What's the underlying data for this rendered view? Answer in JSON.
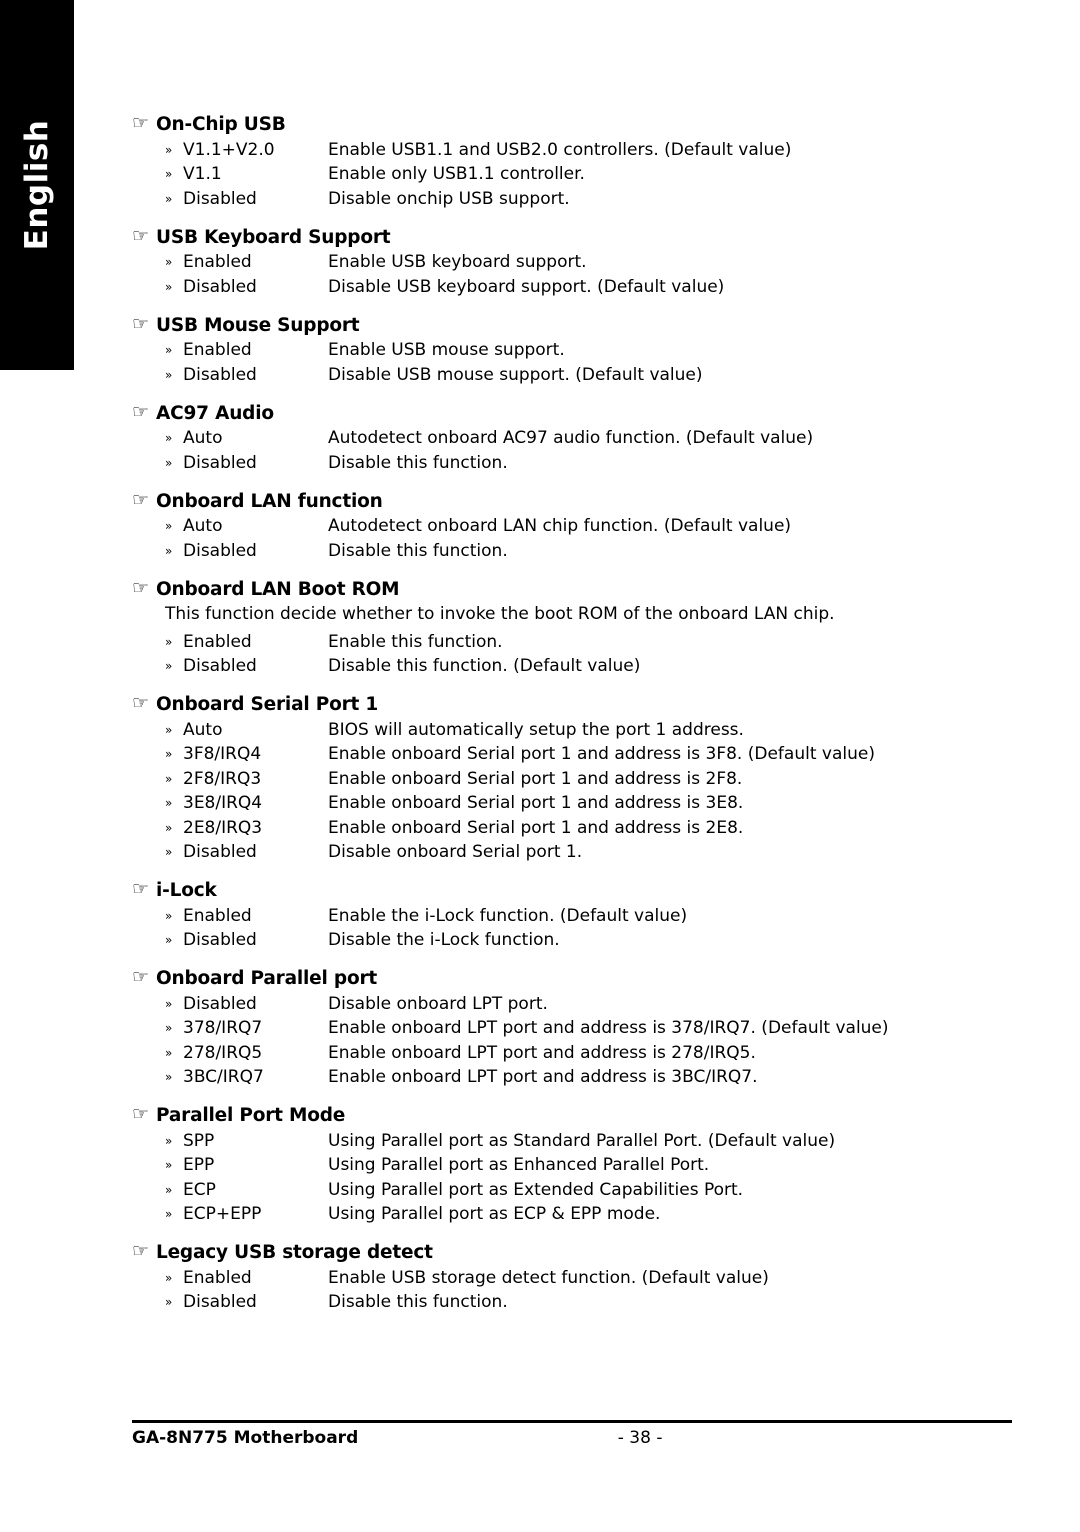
{
  "side_tab": {
    "label": "English"
  },
  "icons": {
    "section_marker": "☞",
    "option_marker": "»"
  },
  "sections": [
    {
      "title": "On-Chip USB",
      "note": null,
      "options": [
        {
          "name": "V1.1+V2.0",
          "desc": "Enable USB1.1 and USB2.0 controllers. (Default value)"
        },
        {
          "name": "V1.1",
          "desc": "Enable only USB1.1 controller."
        },
        {
          "name": "Disabled",
          "desc": "Disable onchip USB support."
        }
      ]
    },
    {
      "title": "USB Keyboard Support",
      "note": null,
      "options": [
        {
          "name": "Enabled",
          "desc": "Enable USB keyboard support."
        },
        {
          "name": "Disabled",
          "desc": "Disable USB keyboard support. (Default value)"
        }
      ]
    },
    {
      "title": "USB Mouse Support",
      "note": null,
      "options": [
        {
          "name": "Enabled",
          "desc": "Enable USB mouse support."
        },
        {
          "name": "Disabled",
          "desc": "Disable USB mouse support. (Default value)"
        }
      ]
    },
    {
      "title": "AC97 Audio",
      "note": null,
      "options": [
        {
          "name": "Auto",
          "desc": "Autodetect onboard AC97 audio function. (Default value)"
        },
        {
          "name": "Disabled",
          "desc": "Disable this function."
        }
      ]
    },
    {
      "title": "Onboard LAN function",
      "note": null,
      "options": [
        {
          "name": "Auto",
          "desc": "Autodetect onboard LAN chip function. (Default value)"
        },
        {
          "name": "Disabled",
          "desc": "Disable this function."
        }
      ]
    },
    {
      "title": "Onboard LAN Boot ROM",
      "note": "This function decide whether to invoke the boot ROM of the onboard LAN chip.",
      "options": [
        {
          "name": "Enabled",
          "desc": "Enable this function."
        },
        {
          "name": "Disabled",
          "desc": "Disable this function. (Default value)"
        }
      ]
    },
    {
      "title": "Onboard Serial Port 1",
      "note": null,
      "options": [
        {
          "name": "Auto",
          "desc": "BIOS will automatically setup the port 1 address."
        },
        {
          "name": "3F8/IRQ4",
          "desc": "Enable onboard Serial port 1 and address is 3F8. (Default value)"
        },
        {
          "name": "2F8/IRQ3",
          "desc": "Enable onboard Serial port 1 and address is 2F8."
        },
        {
          "name": "3E8/IRQ4",
          "desc": "Enable onboard Serial port 1 and address is 3E8."
        },
        {
          "name": "2E8/IRQ3",
          "desc": "Enable onboard Serial port 1 and address is 2E8."
        },
        {
          "name": "Disabled",
          "desc": "Disable onboard Serial port 1."
        }
      ]
    },
    {
      "title": "i-Lock",
      "note": null,
      "options": [
        {
          "name": "Enabled",
          "desc": "Enable the i-Lock function. (Default value)"
        },
        {
          "name": "Disabled",
          "desc": "Disable the i-Lock function."
        }
      ]
    },
    {
      "title": "Onboard Parallel port",
      "note": null,
      "options": [
        {
          "name": "Disabled",
          "desc": "Disable onboard LPT port."
        },
        {
          "name": "378/IRQ7",
          "desc": "Enable onboard LPT port and address is 378/IRQ7. (Default value)"
        },
        {
          "name": "278/IRQ5",
          "desc": "Enable onboard LPT port and address is 278/IRQ5."
        },
        {
          "name": "3BC/IRQ7",
          "desc": "Enable onboard LPT port and address is 3BC/IRQ7."
        }
      ]
    },
    {
      "title": "Parallel Port Mode",
      "note": null,
      "options": [
        {
          "name": "SPP",
          "desc": "Using Parallel port as Standard Parallel Port. (Default value)"
        },
        {
          "name": "EPP",
          "desc": "Using Parallel port as Enhanced Parallel Port."
        },
        {
          "name": "ECP",
          "desc": "Using Parallel port as Extended Capabilities Port."
        },
        {
          "name": "ECP+EPP",
          "desc": "Using Parallel port as ECP & EPP mode."
        }
      ]
    },
    {
      "title": "Legacy USB storage detect",
      "note": null,
      "options": [
        {
          "name": "Enabled",
          "desc": "Enable USB storage detect function. (Default value)"
        },
        {
          "name": "Disabled",
          "desc": "Disable this function."
        }
      ]
    }
  ],
  "footer": {
    "left": "GA-8N775 Motherboard",
    "center": "- 38 -"
  }
}
